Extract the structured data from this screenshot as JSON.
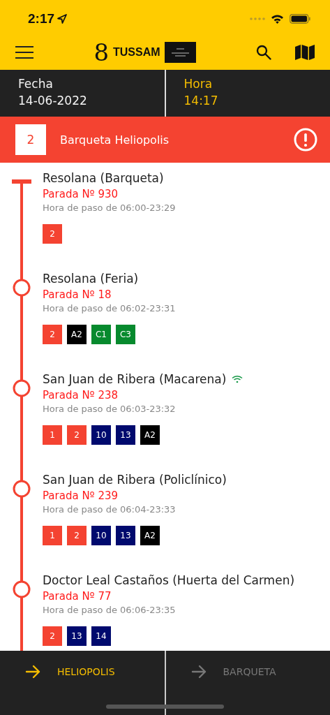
{
  "status_bar": {
    "time": "2:17"
  },
  "header": {
    "logo_mark": "8",
    "logo_text": "TUSSAM"
  },
  "info": [
    {
      "label": "Fecha",
      "value": "14-06-2022",
      "highlight": false
    },
    {
      "label": "Hora",
      "value": "14:17",
      "highlight": true
    }
  ],
  "route": {
    "number": "2",
    "name": "Barqueta Heliopolis"
  },
  "stops": [
    {
      "name": "Resolana (Barqueta)",
      "stop": "Parada Nº 930",
      "hours": "Hora de paso de 06:00-23:29",
      "live": false,
      "lines": [
        {
          "label": "2",
          "color": "#f44331"
        }
      ]
    },
    {
      "name": "Resolana (Feria)",
      "stop": "Parada Nº 18",
      "hours": "Hora de paso de 06:02-23:31",
      "live": false,
      "lines": [
        {
          "label": "2",
          "color": "#f44331"
        },
        {
          "label": "A2",
          "color": "#000000"
        },
        {
          "label": "C1",
          "color": "#078a2e"
        },
        {
          "label": "C3",
          "color": "#078a2e"
        }
      ]
    },
    {
      "name": "San Juan de Ribera (Macarena)",
      "stop": "Parada Nº 238",
      "hours": "Hora de paso de 06:03-23:32",
      "live": true,
      "lines": [
        {
          "label": "1",
          "color": "#f44331"
        },
        {
          "label": "2",
          "color": "#f44331"
        },
        {
          "label": "10",
          "color": "#000a6e"
        },
        {
          "label": "13",
          "color": "#000a6e"
        },
        {
          "label": "A2",
          "color": "#000000"
        }
      ]
    },
    {
      "name": "San Juan de Ribera (Policlínico)",
      "stop": "Parada Nº 239",
      "hours": "Hora de paso de 06:04-23:33",
      "live": false,
      "lines": [
        {
          "label": "1",
          "color": "#f44331"
        },
        {
          "label": "2",
          "color": "#f44331"
        },
        {
          "label": "10",
          "color": "#000a6e"
        },
        {
          "label": "13",
          "color": "#000a6e"
        },
        {
          "label": "A2",
          "color": "#000000"
        }
      ]
    },
    {
      "name": "Doctor Leal Castaños (Huerta del Carmen)",
      "stop": "Parada Nº 77",
      "hours": "Hora de paso de 06:06-23:35",
      "live": false,
      "lines": [
        {
          "label": "2",
          "color": "#f44331"
        },
        {
          "label": "13",
          "color": "#000a6e"
        },
        {
          "label": "14",
          "color": "#000a6e"
        }
      ]
    }
  ],
  "directions": [
    {
      "label": "HELIOPOLIS",
      "selected": true
    },
    {
      "label": "BARQUETA",
      "selected": false
    }
  ]
}
